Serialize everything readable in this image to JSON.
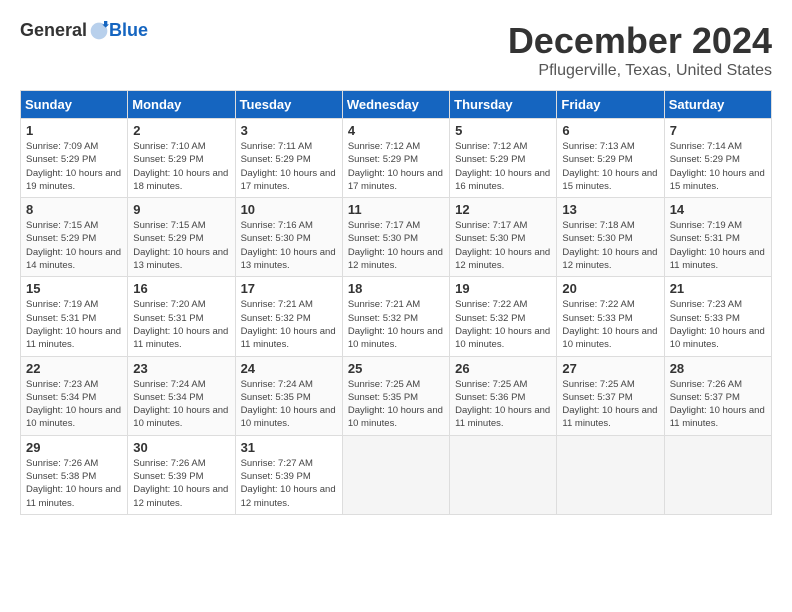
{
  "header": {
    "logo_general": "General",
    "logo_blue": "Blue",
    "title": "December 2024",
    "location": "Pflugerville, Texas, United States"
  },
  "calendar": {
    "days_of_week": [
      "Sunday",
      "Monday",
      "Tuesday",
      "Wednesday",
      "Thursday",
      "Friday",
      "Saturday"
    ],
    "weeks": [
      [
        {
          "day": "1",
          "sunrise": "Sunrise: 7:09 AM",
          "sunset": "Sunset: 5:29 PM",
          "daylight": "Daylight: 10 hours and 19 minutes."
        },
        {
          "day": "2",
          "sunrise": "Sunrise: 7:10 AM",
          "sunset": "Sunset: 5:29 PM",
          "daylight": "Daylight: 10 hours and 18 minutes."
        },
        {
          "day": "3",
          "sunrise": "Sunrise: 7:11 AM",
          "sunset": "Sunset: 5:29 PM",
          "daylight": "Daylight: 10 hours and 17 minutes."
        },
        {
          "day": "4",
          "sunrise": "Sunrise: 7:12 AM",
          "sunset": "Sunset: 5:29 PM",
          "daylight": "Daylight: 10 hours and 17 minutes."
        },
        {
          "day": "5",
          "sunrise": "Sunrise: 7:12 AM",
          "sunset": "Sunset: 5:29 PM",
          "daylight": "Daylight: 10 hours and 16 minutes."
        },
        {
          "day": "6",
          "sunrise": "Sunrise: 7:13 AM",
          "sunset": "Sunset: 5:29 PM",
          "daylight": "Daylight: 10 hours and 15 minutes."
        },
        {
          "day": "7",
          "sunrise": "Sunrise: 7:14 AM",
          "sunset": "Sunset: 5:29 PM",
          "daylight": "Daylight: 10 hours and 15 minutes."
        }
      ],
      [
        {
          "day": "8",
          "sunrise": "Sunrise: 7:15 AM",
          "sunset": "Sunset: 5:29 PM",
          "daylight": "Daylight: 10 hours and 14 minutes."
        },
        {
          "day": "9",
          "sunrise": "Sunrise: 7:15 AM",
          "sunset": "Sunset: 5:29 PM",
          "daylight": "Daylight: 10 hours and 13 minutes."
        },
        {
          "day": "10",
          "sunrise": "Sunrise: 7:16 AM",
          "sunset": "Sunset: 5:30 PM",
          "daylight": "Daylight: 10 hours and 13 minutes."
        },
        {
          "day": "11",
          "sunrise": "Sunrise: 7:17 AM",
          "sunset": "Sunset: 5:30 PM",
          "daylight": "Daylight: 10 hours and 12 minutes."
        },
        {
          "day": "12",
          "sunrise": "Sunrise: 7:17 AM",
          "sunset": "Sunset: 5:30 PM",
          "daylight": "Daylight: 10 hours and 12 minutes."
        },
        {
          "day": "13",
          "sunrise": "Sunrise: 7:18 AM",
          "sunset": "Sunset: 5:30 PM",
          "daylight": "Daylight: 10 hours and 12 minutes."
        },
        {
          "day": "14",
          "sunrise": "Sunrise: 7:19 AM",
          "sunset": "Sunset: 5:31 PM",
          "daylight": "Daylight: 10 hours and 11 minutes."
        }
      ],
      [
        {
          "day": "15",
          "sunrise": "Sunrise: 7:19 AM",
          "sunset": "Sunset: 5:31 PM",
          "daylight": "Daylight: 10 hours and 11 minutes."
        },
        {
          "day": "16",
          "sunrise": "Sunrise: 7:20 AM",
          "sunset": "Sunset: 5:31 PM",
          "daylight": "Daylight: 10 hours and 11 minutes."
        },
        {
          "day": "17",
          "sunrise": "Sunrise: 7:21 AM",
          "sunset": "Sunset: 5:32 PM",
          "daylight": "Daylight: 10 hours and 11 minutes."
        },
        {
          "day": "18",
          "sunrise": "Sunrise: 7:21 AM",
          "sunset": "Sunset: 5:32 PM",
          "daylight": "Daylight: 10 hours and 10 minutes."
        },
        {
          "day": "19",
          "sunrise": "Sunrise: 7:22 AM",
          "sunset": "Sunset: 5:32 PM",
          "daylight": "Daylight: 10 hours and 10 minutes."
        },
        {
          "day": "20",
          "sunrise": "Sunrise: 7:22 AM",
          "sunset": "Sunset: 5:33 PM",
          "daylight": "Daylight: 10 hours and 10 minutes."
        },
        {
          "day": "21",
          "sunrise": "Sunrise: 7:23 AM",
          "sunset": "Sunset: 5:33 PM",
          "daylight": "Daylight: 10 hours and 10 minutes."
        }
      ],
      [
        {
          "day": "22",
          "sunrise": "Sunrise: 7:23 AM",
          "sunset": "Sunset: 5:34 PM",
          "daylight": "Daylight: 10 hours and 10 minutes."
        },
        {
          "day": "23",
          "sunrise": "Sunrise: 7:24 AM",
          "sunset": "Sunset: 5:34 PM",
          "daylight": "Daylight: 10 hours and 10 minutes."
        },
        {
          "day": "24",
          "sunrise": "Sunrise: 7:24 AM",
          "sunset": "Sunset: 5:35 PM",
          "daylight": "Daylight: 10 hours and 10 minutes."
        },
        {
          "day": "25",
          "sunrise": "Sunrise: 7:25 AM",
          "sunset": "Sunset: 5:35 PM",
          "daylight": "Daylight: 10 hours and 10 minutes."
        },
        {
          "day": "26",
          "sunrise": "Sunrise: 7:25 AM",
          "sunset": "Sunset: 5:36 PM",
          "daylight": "Daylight: 10 hours and 11 minutes."
        },
        {
          "day": "27",
          "sunrise": "Sunrise: 7:25 AM",
          "sunset": "Sunset: 5:37 PM",
          "daylight": "Daylight: 10 hours and 11 minutes."
        },
        {
          "day": "28",
          "sunrise": "Sunrise: 7:26 AM",
          "sunset": "Sunset: 5:37 PM",
          "daylight": "Daylight: 10 hours and 11 minutes."
        }
      ],
      [
        {
          "day": "29",
          "sunrise": "Sunrise: 7:26 AM",
          "sunset": "Sunset: 5:38 PM",
          "daylight": "Daylight: 10 hours and 11 minutes."
        },
        {
          "day": "30",
          "sunrise": "Sunrise: 7:26 AM",
          "sunset": "Sunset: 5:39 PM",
          "daylight": "Daylight: 10 hours and 12 minutes."
        },
        {
          "day": "31",
          "sunrise": "Sunrise: 7:27 AM",
          "sunset": "Sunset: 5:39 PM",
          "daylight": "Daylight: 10 hours and 12 minutes."
        },
        null,
        null,
        null,
        null
      ]
    ]
  }
}
